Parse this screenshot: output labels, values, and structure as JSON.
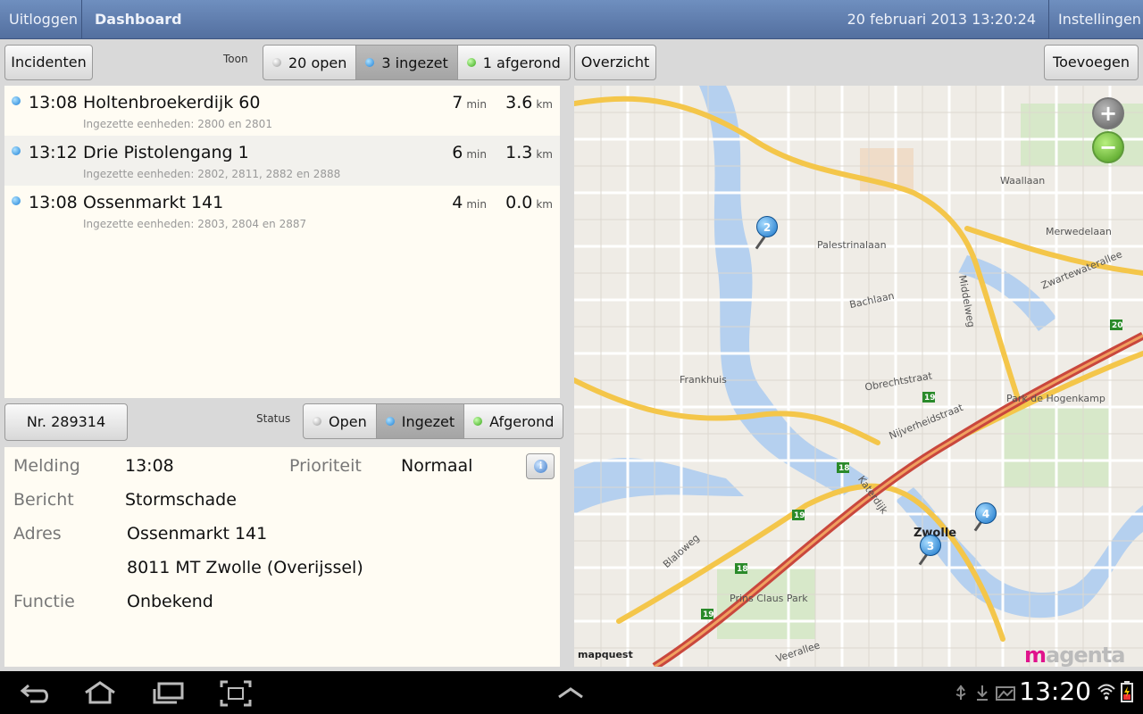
{
  "topbar": {
    "logout_label": "Uitloggen",
    "title": "Dashboard",
    "datetime": "20 februari 2013   13:20:24",
    "settings_label": "Instellingen"
  },
  "incidents_panel": {
    "button_label": "Incidenten",
    "toon_label": "Toon",
    "filters": [
      {
        "label": "20 open",
        "dot": "gray",
        "active": false
      },
      {
        "label": "3 ingezet",
        "dot": "blue",
        "active": true
      },
      {
        "label": "1 afgerond",
        "dot": "green",
        "active": false
      }
    ],
    "items": [
      {
        "time": "13:08",
        "address": "Holtenbroekerdijk 60",
        "units": "Ingezette eenheden: 2800 en 2801",
        "min": "7",
        "min_unit": "min",
        "km": "3.6",
        "km_unit": "km"
      },
      {
        "time": "13:12",
        "address": "Drie Pistolengang 1",
        "units": "Ingezette eenheden: 2802, 2811, 2882 en 2888",
        "min": "6",
        "min_unit": "min",
        "km": "1.3",
        "km_unit": "km"
      },
      {
        "time": "13:08",
        "address": "Ossenmarkt 141",
        "units": "Ingezette eenheden: 2803, 2804 en 2887",
        "min": "4",
        "min_unit": "min",
        "km": "0.0",
        "km_unit": "km"
      }
    ]
  },
  "detail_panel": {
    "number_label": "Nr. 289314",
    "status_label": "Status",
    "status_options": [
      {
        "label": "Open",
        "dot": "gray",
        "active": false
      },
      {
        "label": "Ingezet",
        "dot": "blue",
        "active": true
      },
      {
        "label": "Afgerond",
        "dot": "green",
        "active": false
      }
    ],
    "fields": {
      "melding_label": "Melding",
      "melding_value": "13:08",
      "prioriteit_label": "Prioriteit",
      "prioriteit_value": "Normaal",
      "bericht_label": "Bericht",
      "bericht_value": "Stormschade",
      "adres_label": "Adres",
      "adres_line1": "Ossenmarkt 141",
      "adres_line2": "8011 MT Zwolle (Overijssel)",
      "functie_label": "Functie",
      "functie_value": "Onbekend"
    },
    "info_icon": "info-icon"
  },
  "map_panel": {
    "overview_label": "Overzicht",
    "add_label": "Toevoegen",
    "zoom_in": "+",
    "zoom_out": "−",
    "labels": {
      "frankhuis": "Frankhuis",
      "zwolle": "Zwolle",
      "zwartewaterallee": "Zwartewaterallee",
      "middelweg": "Middelweg",
      "blaloweg": "Blaloweg",
      "katerdijk": "Katerdijk",
      "palestrinalaan": "Palestrinalaan",
      "bachlaan": "Bachlaan",
      "park_hogenkamp": "Park de Hogenkamp",
      "prins_claus_park": "Prins Claus Park",
      "waallaan": "Waallaan",
      "merwedelaan": "Merwedelaan",
      "veerallee": "Veerallee",
      "nijverheidstraat": "Nijverheidstraat",
      "obrechtstraat": "Obrechtstraat"
    },
    "pins": [
      "2",
      "3",
      "4"
    ],
    "route_badges": [
      "18",
      "19",
      "19",
      "18",
      "19",
      "20"
    ],
    "attribution": "mapquest",
    "brand_m": "m",
    "brand_rest": "agenta"
  },
  "systembar": {
    "clock": "13:20"
  }
}
